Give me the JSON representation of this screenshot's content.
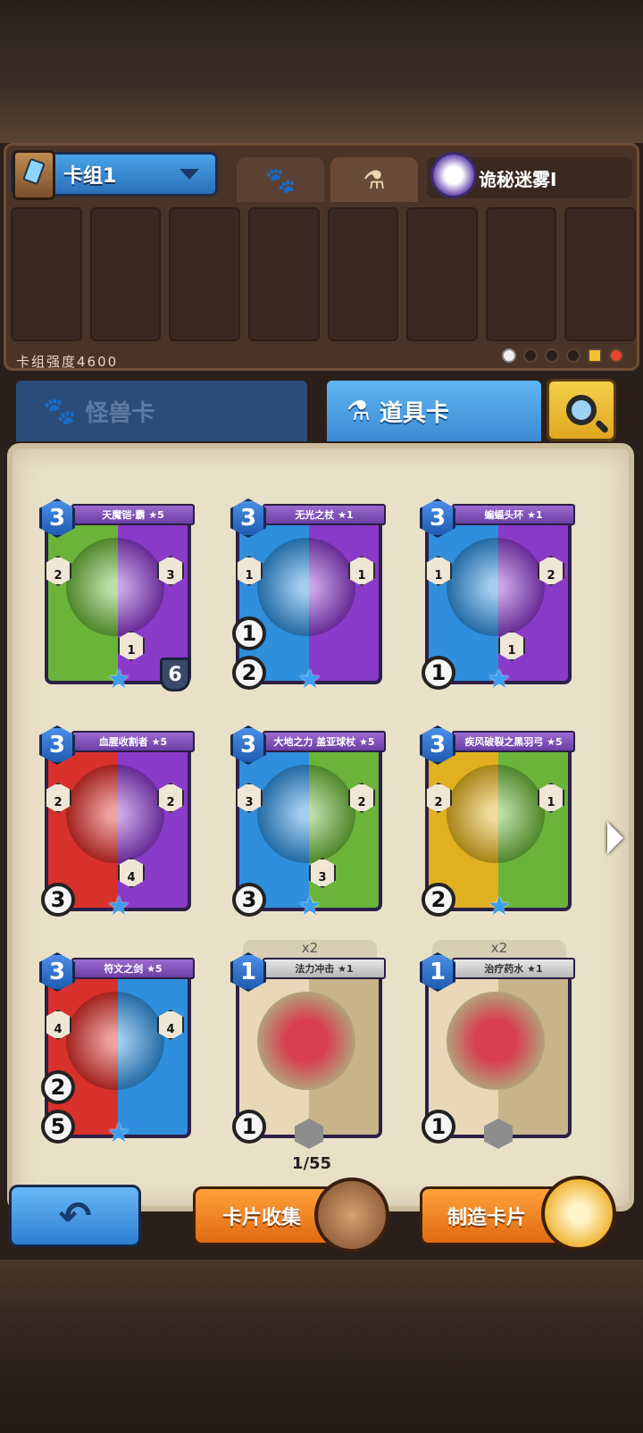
{
  "deck": {
    "name": "卡组1",
    "mist_name": "诡秘迷雾Ⅰ",
    "power_label": "卡组强度4600"
  },
  "category_tabs": {
    "monster": "怪兽卡",
    "item": "道具卡"
  },
  "cards": [
    {
      "name": "天魔铠·霸 ★5",
      "cost": "3",
      "stats": [
        "2",
        "3",
        "1"
      ],
      "bottom_left": "",
      "level": "6",
      "colors": [
        "#6ab43a",
        "#8a3ac8"
      ]
    },
    {
      "name": "无光之杖 ★1",
      "cost": "3",
      "stats": [
        "1",
        "1"
      ],
      "bottom_left": "1",
      "bottom_left2": "2",
      "colors": [
        "#2f8fdc",
        "#8a3ac8"
      ]
    },
    {
      "name": "蝙蝠头环 ★1",
      "cost": "3",
      "stats": [
        "1",
        "2",
        "1"
      ],
      "bottom_left": "1",
      "colors": [
        "#2f8fdc",
        "#8a3ac8"
      ]
    },
    {
      "name": "血腥收割者 ★5",
      "cost": "3",
      "stats": [
        "2",
        "2",
        "4"
      ],
      "bottom_left": "3",
      "colors": [
        "#d8302a",
        "#8a3ac8"
      ]
    },
    {
      "name": "大地之力 盖亚球杖 ★5",
      "cost": "3",
      "stats": [
        "3",
        "2",
        "3"
      ],
      "bottom_left": "3",
      "colors": [
        "#2f8fdc",
        "#6ab43a"
      ]
    },
    {
      "name": "疾风破裂之黑羽弓 ★5",
      "cost": "3",
      "stats": [
        "2",
        "1"
      ],
      "bottom_left": "2",
      "colors": [
        "#e0b020",
        "#6ab43a"
      ]
    },
    {
      "name": "符文之剑 ★5",
      "cost": "3",
      "stats": [
        "4",
        "4"
      ],
      "bottom_left": "2",
      "bottom_left2": "5",
      "colors": [
        "#d8302a",
        "#2f8fdc"
      ]
    },
    {
      "name": "法力冲击 ★1",
      "cost": "1",
      "count": "x2",
      "bottom_left": "1",
      "colors": [
        "#e8d8b8",
        "#c8b48a"
      ]
    },
    {
      "name": "治疗药水 ★1",
      "cost": "1",
      "count": "x2",
      "bottom_left": "1",
      "colors": [
        "#e8d8b8",
        "#c8b48a"
      ]
    }
  ],
  "progress": "1/55",
  "buttons": {
    "collect": "卡片收集",
    "craft": "制造卡片"
  }
}
